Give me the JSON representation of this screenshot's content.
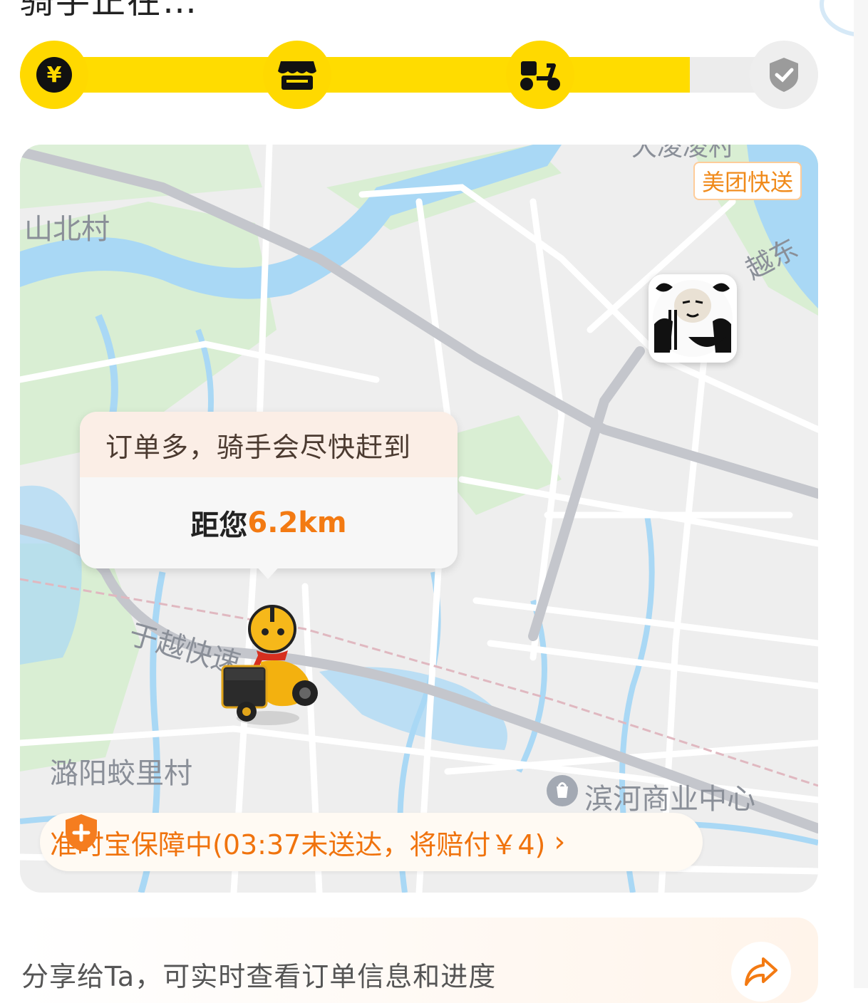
{
  "header": {
    "partial_text": "骑手正在…"
  },
  "progress": {
    "steps": [
      {
        "icon": "yuan-coin-icon",
        "symbol": "¥",
        "state": "done"
      },
      {
        "icon": "store-icon",
        "state": "done"
      },
      {
        "icon": "rider-scooter-icon",
        "state": "done"
      },
      {
        "icon": "check-circle-icon",
        "state": "pending"
      }
    ],
    "fill_fraction": 0.84,
    "colors": {
      "active": "#ffd900",
      "inactive": "#eeeeee"
    }
  },
  "map": {
    "service_badge": "美团快送",
    "places": {
      "north_village": "山北村",
      "upper_top": "大凌凌村",
      "road_east": "越东",
      "expressway": "于越快速",
      "south_village": "潞阳蛟里村",
      "business_center": "滨河商业中心"
    },
    "bubble": {
      "status": "订单多，骑手会尽快赶到",
      "distance_prefix": "距您",
      "distance_value": "6.2km"
    },
    "guarantee": {
      "text": "准时宝保障中(03:37未送达，将赔付￥4)",
      "icon": "shield-plus-icon"
    }
  },
  "share": {
    "text": "分享给Ta，可实时查看订单信息和进度",
    "icon": "share-arrow-icon"
  },
  "colors": {
    "accent_yellow": "#ffd900",
    "orange": "#f37a12",
    "water": "#a9d8f5",
    "green": "#d9eed3"
  }
}
